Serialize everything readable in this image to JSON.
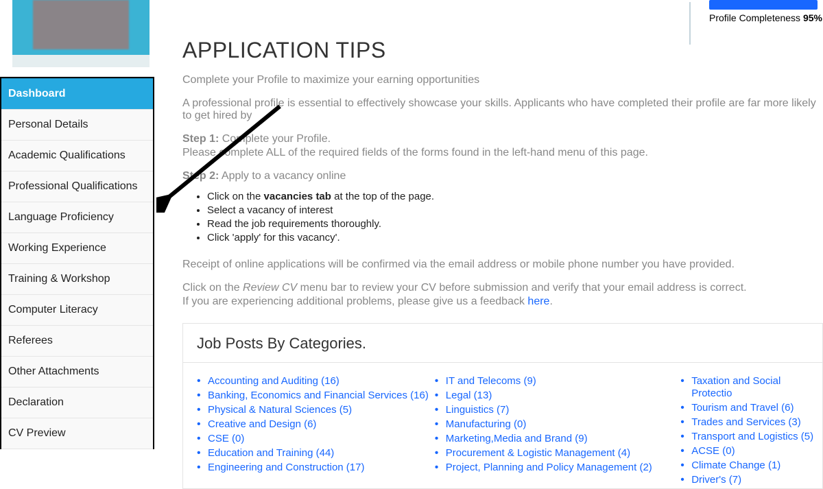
{
  "completeness": {
    "label": "Profile Completeness ",
    "pct": "95%"
  },
  "sidebar": {
    "items": [
      "Dashboard",
      "Personal Details",
      "Academic Qualifications",
      "Professional Qualifications",
      "Language Proficiency",
      "Working Experience",
      "Training & Workshop",
      "Computer Literacy",
      "Referees",
      "Other Attachments",
      "Declaration",
      "CV Preview"
    ]
  },
  "title": "APPLICATION TIPS",
  "subtitle": "Complete your Profile to maximize your earning opportunities",
  "intro": "A professional profile is essential to effectively showcase your skills. Applicants who have completed their profile are far more likely to get hired by",
  "step1": {
    "label": "Step 1:",
    "text": " Complete your Profile."
  },
  "step1_line2": "Please complete ALL of the required fields of the forms found in the left-hand menu of this page.",
  "step2": {
    "label": "Step 2:",
    "text": " Apply to a vacancy online"
  },
  "bullets": {
    "b1a": "Click on the ",
    "b1b": "vacancies tab",
    "b1c": " at the top of the page.",
    "b2": "Select a vacancy of interest",
    "b3": "Read the job requirements thoroughly.",
    "b4": "Click 'apply' for this vacancy'."
  },
  "receipt": "Receipt of online applications will be confirmed via the email address or mobile phone number you have provided.",
  "review_a": "Click on the ",
  "review_i": "Review CV",
  "review_b": " menu bar to review your CV before submission and verify that your email address is correct.",
  "feedback_a": "If you are experiencing additional problems, please give us a feedback ",
  "feedback_link": "here",
  "feedback_b": ".",
  "panel_title": "Job Posts By Categories.",
  "cats": {
    "col1": [
      "Accounting and Auditing (16)",
      "Banking, Economics and Financial Services (16)",
      "Physical & Natural Sciences (5)",
      "Creative and Design (6)",
      "CSE (0)",
      "Education and Training (44)",
      "Engineering and Construction (17)"
    ],
    "col2": [
      "IT and Telecoms (9)",
      "Legal (13)",
      "Linguistics (7)",
      "Manufacturing (0)",
      "Marketing,Media and Brand (9)",
      "Procurement & Logistic Management (4)",
      "Project, Planning and Policy Management (2)"
    ],
    "col3": [
      "Taxation and Social Protectio",
      "Tourism and Travel (6)",
      "Trades and Services (3)",
      "Transport and Logistics (5)",
      "ACSE (0)",
      "Climate Change (1)",
      "Driver's (7)"
    ]
  }
}
